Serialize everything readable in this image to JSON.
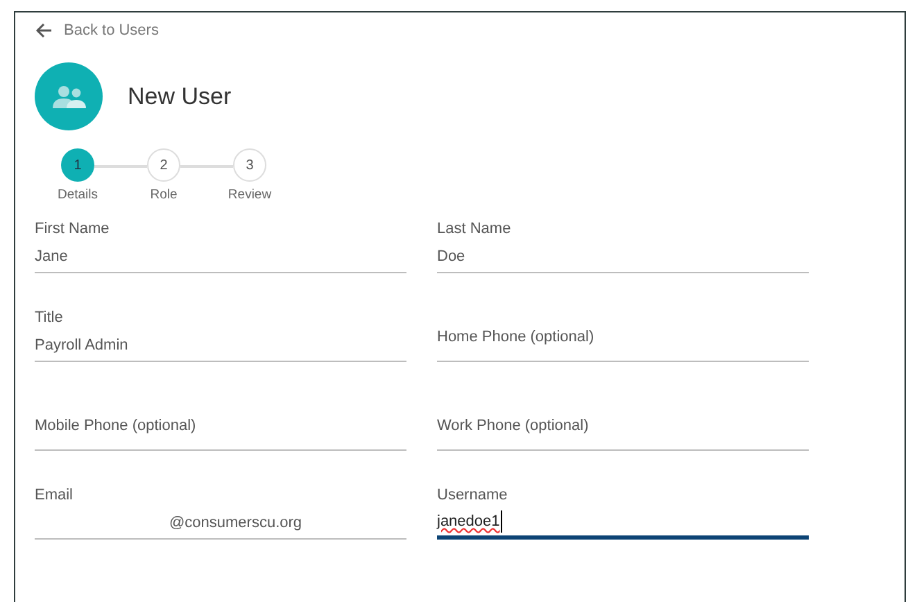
{
  "back_link": "Back to Users",
  "title": "New User",
  "steps": [
    {
      "number": "1",
      "label": "Details",
      "selected": true
    },
    {
      "number": "2",
      "label": "Role",
      "selected": false
    },
    {
      "number": "3",
      "label": "Review",
      "selected": false
    }
  ],
  "fields": [
    {
      "label": "First Name",
      "value": "Jane",
      "focused": false
    },
    {
      "label": "Last Name",
      "value": "Doe",
      "focused": false
    },
    {
      "label": "Title",
      "value": "Payroll Admin",
      "focused": false
    },
    {
      "label": "Home Phone (optional)",
      "focused": false
    },
    {
      "label": "Mobile Phone (optional)",
      "focused": false
    },
    {
      "label": "Work Phone (optional)",
      "focused": false
    },
    {
      "label": "Email",
      "suffix": "@consumerscu.org",
      "focused": false
    },
    {
      "label": "Username",
      "value": "janedoe1",
      "focused": true
    }
  ]
}
